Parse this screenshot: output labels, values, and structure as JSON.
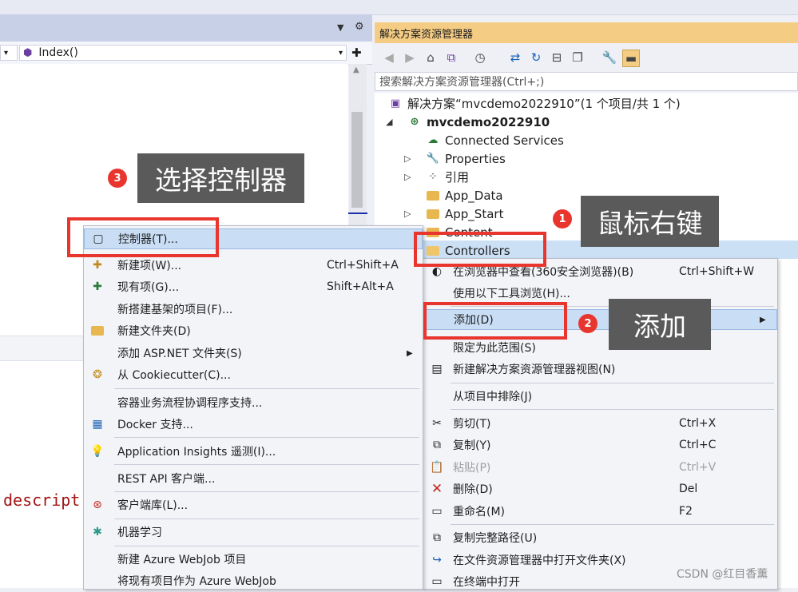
{
  "editor": {
    "method_selector": "Index()",
    "code_fragment": "descript"
  },
  "solution_explorer": {
    "title": "解决方案资源管理器",
    "search_placeholder": "搜索解决方案资源管理器(Ctrl+;)",
    "tree": {
      "solution": "解决方案“mvcdemo2022910”(1 个项目/共 1 个)",
      "project": "mvcdemo2022910",
      "items": [
        "Connected Services",
        "Properties",
        "引用",
        "App_Data",
        "App_Start",
        "Content",
        "Controllers"
      ]
    }
  },
  "context_menu": {
    "items": [
      {
        "label": "在浏览器中查看(360安全浏览器)(B)",
        "shortcut": "Ctrl+Shift+W"
      },
      {
        "label": "使用以下工具浏览(H)...",
        "shortcut": ""
      },
      {
        "label": "添加(D)",
        "shortcut": ""
      },
      {
        "label": "限定为此范围(S)",
        "shortcut": ""
      },
      {
        "label": "新建解决方案资源管理器视图(N)",
        "shortcut": ""
      },
      {
        "label": "从项目中排除(J)",
        "shortcut": ""
      },
      {
        "label": "剪切(T)",
        "shortcut": "Ctrl+X"
      },
      {
        "label": "复制(Y)",
        "shortcut": "Ctrl+C"
      },
      {
        "label": "粘贴(P)",
        "shortcut": "Ctrl+V"
      },
      {
        "label": "删除(D)",
        "shortcut": "Del"
      },
      {
        "label": "重命名(M)",
        "shortcut": "F2"
      },
      {
        "label": "复制完整路径(U)",
        "shortcut": ""
      },
      {
        "label": "在文件资源管理器中打开文件夹(X)",
        "shortcut": ""
      },
      {
        "label": "在终端中打开",
        "shortcut": ""
      }
    ]
  },
  "add_submenu": {
    "items": [
      {
        "label": "控制器(T)...",
        "shortcut": ""
      },
      {
        "label": "新建项(W)...",
        "shortcut": "Ctrl+Shift+A"
      },
      {
        "label": "现有项(G)...",
        "shortcut": "Shift+Alt+A"
      },
      {
        "label": "新搭建基架的项目(F)...",
        "shortcut": ""
      },
      {
        "label": "新建文件夹(D)",
        "shortcut": ""
      },
      {
        "label": "添加 ASP.NET 文件夹(S)",
        "shortcut": ""
      },
      {
        "label": "从 Cookiecutter(C)...",
        "shortcut": ""
      },
      {
        "label": "容器业务流程协调程序支持...",
        "shortcut": ""
      },
      {
        "label": "Docker 支持...",
        "shortcut": ""
      },
      {
        "label": "Application Insights 遥测(I)...",
        "shortcut": ""
      },
      {
        "label": "REST API 客户端...",
        "shortcut": ""
      },
      {
        "label": "客户端库(L)...",
        "shortcut": ""
      },
      {
        "label": "机器学习",
        "shortcut": ""
      },
      {
        "label": "新建 Azure WebJob 项目",
        "shortcut": ""
      },
      {
        "label": "将现有项目作为 Azure WebJob",
        "shortcut": ""
      }
    ]
  },
  "annotations": [
    {
      "number": "1",
      "text": "鼠标右键"
    },
    {
      "number": "2",
      "text": "添加"
    },
    {
      "number": "3",
      "text": "选择控制器"
    }
  ],
  "watermark": "CSDN @红目香薰",
  "colors": {
    "annotation_red": "#e8362f",
    "callout_bg": "#5a5a5a",
    "title_bar": "#f5cc84",
    "selection": "#cce0f5"
  }
}
